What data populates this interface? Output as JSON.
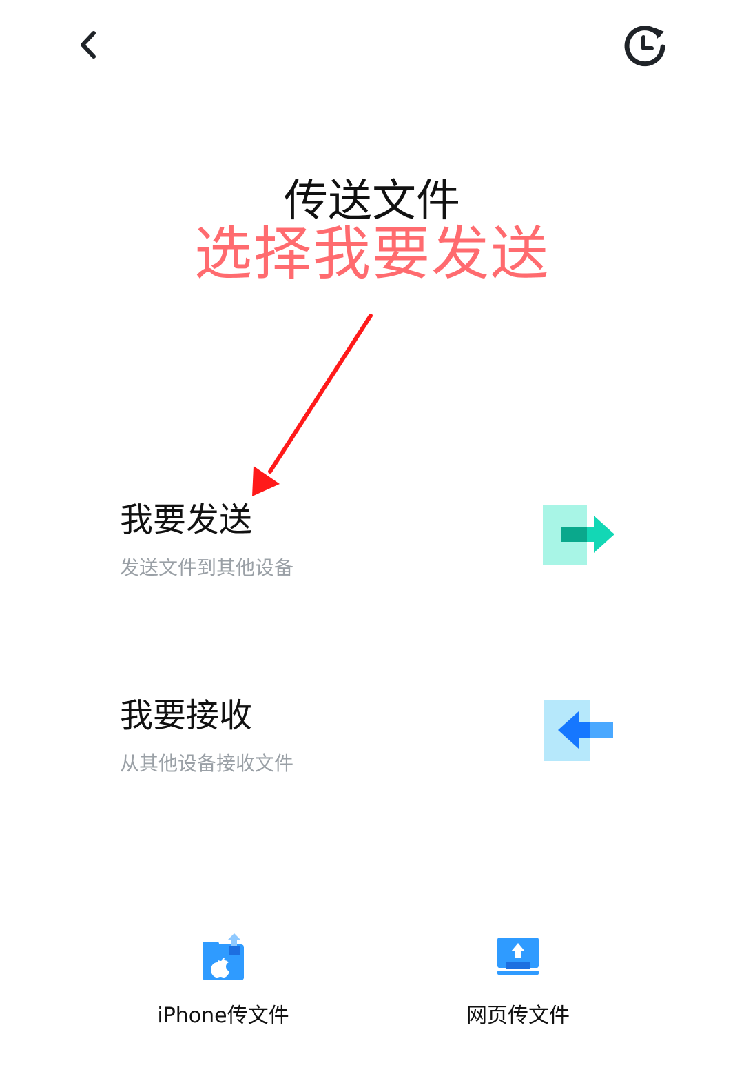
{
  "header": {
    "back_icon": "chevron-left-icon",
    "history_icon": "history-clock-icon"
  },
  "title": "传送文件",
  "annotation": {
    "text": "选择我要发送",
    "color": "#ff6b6f",
    "arrow_color": "#ff1a1a"
  },
  "options": {
    "send": {
      "title": "我要发送",
      "subtitle": "发送文件到其他设备",
      "icon": "send-arrow-right-icon",
      "colors": {
        "box": "#a8f5e6",
        "arrow": "#13d7b5",
        "shadow": "#0aa88c"
      }
    },
    "receive": {
      "title": "我要接收",
      "subtitle": "从其他设备接收文件",
      "icon": "receive-arrow-left-icon",
      "colors": {
        "box": "#b6e8fb",
        "arrow": "#1677ff",
        "shadow": "#4aa8ff"
      }
    }
  },
  "bottom": {
    "iphone": {
      "label": "iPhone传文件",
      "icon": "iphone-folder-upload-icon"
    },
    "web": {
      "label": "网页传文件",
      "icon": "web-monitor-upload-icon"
    },
    "accent": "#2f9bff"
  }
}
